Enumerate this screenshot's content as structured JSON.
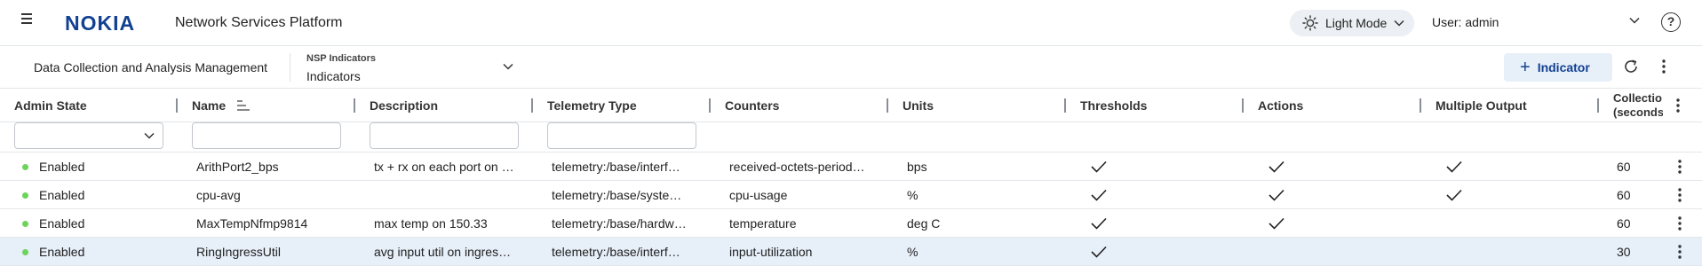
{
  "header": {
    "logo": "NOKIA",
    "app_title": "Network Services Platform",
    "mode_label": "Light Mode",
    "user_label": "User: admin",
    "help": "?"
  },
  "toolbar": {
    "breadcrumb": "Data Collection and Analysis Management",
    "selector_label": "NSP Indicators",
    "selector_value": "Indicators",
    "add_label": "Indicator"
  },
  "columns": [
    "Admin State",
    "Name",
    "Description",
    "Telemetry Type",
    "Counters",
    "Units",
    "Thresholds",
    "Actions",
    "Multiple Output"
  ],
  "last_column": {
    "line1": "Collectio",
    "line2": "(seconds"
  },
  "rows": [
    {
      "admin_state": "Enabled",
      "name": "ArithPort2_bps",
      "description": "tx + rx on each port on …",
      "telemetry_type": "telemetry:/base/interf…",
      "counters": "received-octets-period…",
      "units": "bps",
      "thresholds": true,
      "actions": true,
      "multiple_output": true,
      "collection": "60"
    },
    {
      "admin_state": "Enabled",
      "name": "cpu-avg",
      "description": "",
      "telemetry_type": "telemetry:/base/syste…",
      "counters": "cpu-usage",
      "units": "%",
      "thresholds": true,
      "actions": true,
      "multiple_output": true,
      "collection": "60"
    },
    {
      "admin_state": "Enabled",
      "name": "MaxTempNfmp9814",
      "description": "max temp on 150.33",
      "telemetry_type": "telemetry:/base/hardw…",
      "counters": "temperature",
      "units": "deg C",
      "thresholds": true,
      "actions": true,
      "multiple_output": false,
      "collection": "60"
    },
    {
      "admin_state": "Enabled",
      "name": "RingIngressUtil",
      "description": "avg input util on ingres…",
      "telemetry_type": "telemetry:/base/interf…",
      "counters": "input-utilization",
      "units": "%",
      "thresholds": true,
      "actions": false,
      "multiple_output": false,
      "collection": "30",
      "selected": true
    }
  ],
  "colors": {
    "brand": "#124191",
    "enabled_dot": "#6dd35b",
    "selected_row": "#e7eff9"
  }
}
